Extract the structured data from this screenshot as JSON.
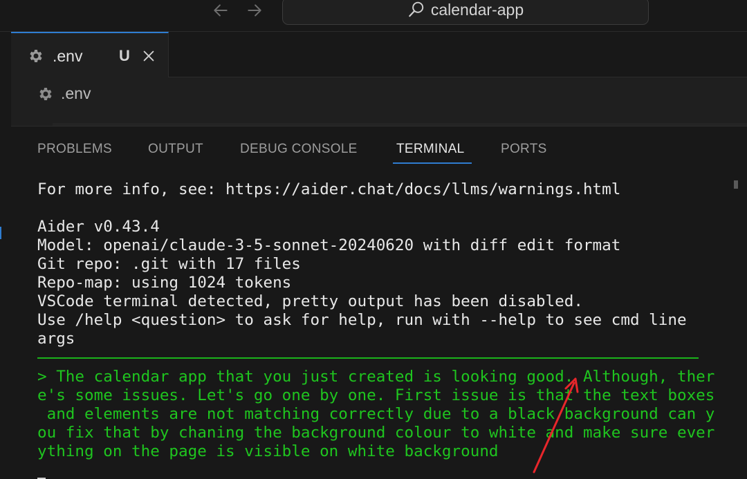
{
  "titlebar": {
    "search_label": "calendar-app",
    "back_icon": "arrow-left-icon",
    "forward_icon": "arrow-right-icon"
  },
  "editor_tab": {
    "label": ".env",
    "status": "U",
    "icon": "gear-icon"
  },
  "breadcrumb": {
    "label": ".env",
    "icon": "gear-icon"
  },
  "panel": {
    "tabs": [
      {
        "label": "PROBLEMS"
      },
      {
        "label": "OUTPUT"
      },
      {
        "label": "DEBUG CONSOLE"
      },
      {
        "label": "TERMINAL"
      },
      {
        "label": "PORTS"
      }
    ],
    "active_tab": "TERMINAL"
  },
  "terminal": {
    "lines": [
      "For more info, see: https://aider.chat/docs/llms/warnings.html",
      "",
      "Aider v0.43.4",
      "Model: openai/claude-3-5-sonnet-20240620 with diff edit format",
      "Git repo: .git with 17 files",
      "Repo-map: using 1024 tokens",
      "VSCode terminal detected, pretty output has been disabled.",
      "Use /help <question> to ask for help, run with --help to see cmd line",
      "args"
    ],
    "prompt_lines": [
      "> The calendar app that you just created is looking good. Although, ther",
      "e's some issues. Let's go one by one. First issue is that the text boxes",
      " and elements are not matching correctly due to a black background can y",
      "ou fix that by chaning the background colour to white and make sure ever",
      "ything on the page is visible on white background"
    ]
  },
  "colors": {
    "accent": "#2f7dd1",
    "prompt_green": "#1fc51f",
    "annotation_red": "#e8262b"
  }
}
